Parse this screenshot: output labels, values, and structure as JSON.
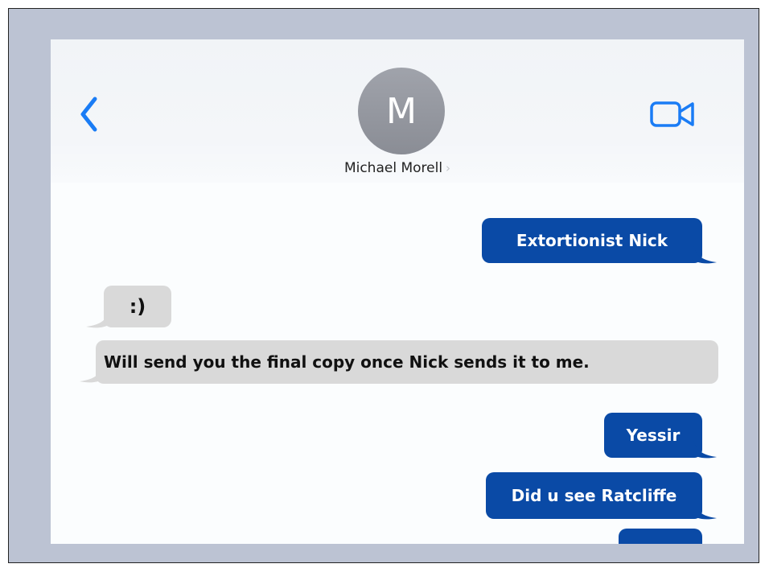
{
  "header": {
    "avatar_initial": "M",
    "contact_name": "Michael Morell",
    "name_chevron": "›",
    "icons": {
      "back": "chevron-left-icon",
      "video": "video-camera-icon"
    },
    "accent_color": "#1a7cf5"
  },
  "messages": [
    {
      "direction": "outgoing",
      "text": "Extortionist Nick"
    },
    {
      "direction": "incoming",
      "text": ":)"
    },
    {
      "direction": "incoming",
      "text": "Will send you the final copy once Nick sends it to me."
    },
    {
      "direction": "outgoing",
      "text": "Yessir"
    },
    {
      "direction": "outgoing",
      "text": "Did u see Ratcliffe"
    },
    {
      "direction": "outgoing",
      "text": ""
    }
  ],
  "colors": {
    "outgoing_bubble": "#0a4aa6",
    "incoming_bubble": "#d9d9d9",
    "frame_background": "#bcc3d3"
  }
}
